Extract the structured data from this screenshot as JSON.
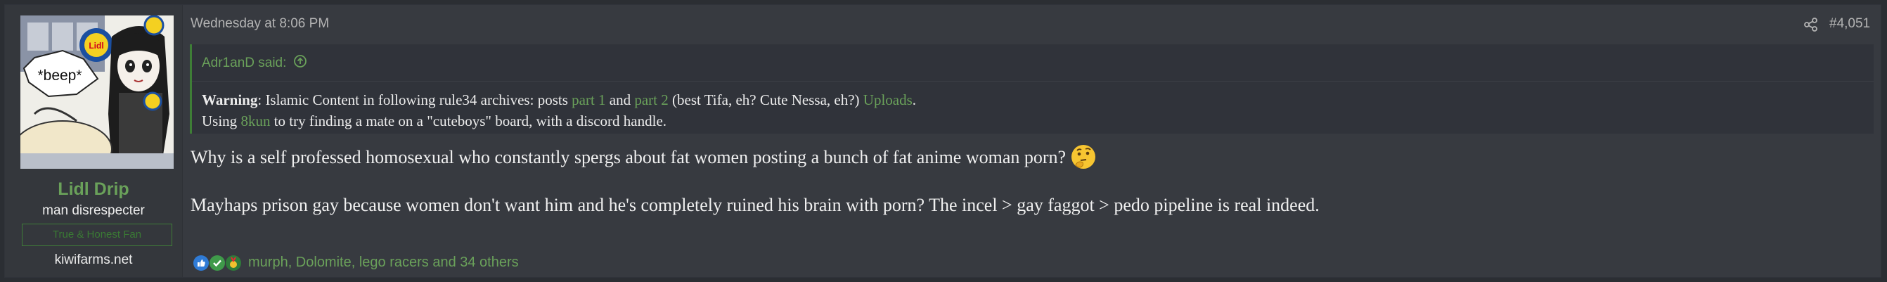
{
  "post": {
    "user": {
      "avatar_text": "*beep*",
      "name": "Lidl Drip",
      "title": "man disrespecter",
      "banner": "True & Honest Fan",
      "site": "kiwifarms.net"
    },
    "date": "Wednesday at 8:06 PM",
    "number": "#4,051",
    "quote": {
      "author_said": "Adr1anD said:",
      "line1": {
        "warning": "Warning",
        "text_a": ": Islamic Content in following rule34 archives: posts ",
        "link_part1": "part 1",
        "text_b": " and ",
        "link_part2": "part 2",
        "text_c": " (best Tifa, eh? Cute Nessa, eh?) ",
        "link_uploads": "Uploads",
        "text_d": "."
      },
      "line2": {
        "text_a": "Using ",
        "link_8kun": "8kun",
        "text_b": " to try finding a mate on a \"cuteboys\" board, with a discord handle."
      }
    },
    "message": {
      "para1": "Why is a self professed homosexual who constantly spergs about fat women posting a bunch of fat anime woman porn?",
      "para1_emoji": "thinking-face",
      "para2": "Mayhaps prison gay because women don't want him and he's completely ruined his brain with porn? The incel > gay faggot > pedo pipeline is real indeed."
    },
    "reactions": {
      "icons": [
        "like",
        "agree",
        "winner"
      ],
      "users": "murph, Dolomite, lego racers and 34 others"
    }
  },
  "colors": {
    "accent_green": "#6aa15a",
    "background": "#373a40"
  }
}
